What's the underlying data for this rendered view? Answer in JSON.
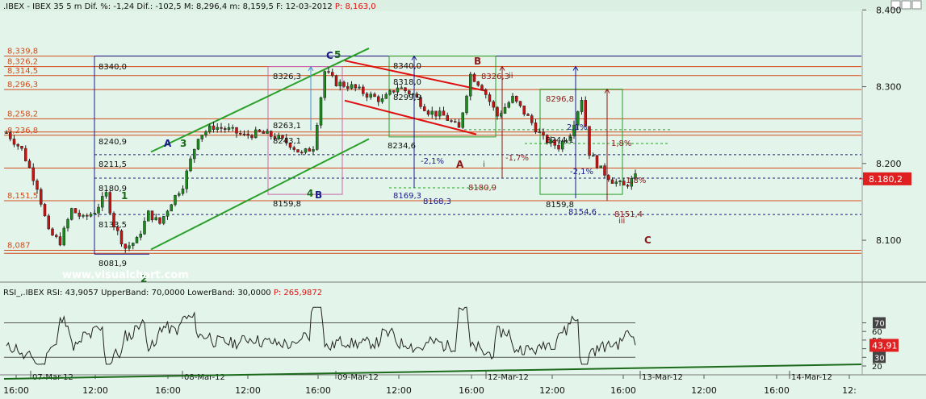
{
  "header": {
    "symbol": ".IBEX - IBEX 35",
    "timeframe": "5 m",
    "dif_pct_label": "Dif. %:",
    "dif_pct": "-1,24",
    "dif_label": "Dif.:",
    "dif": "-102,5",
    "max_label": "M:",
    "max": "8,296,4",
    "min_label": "m:",
    "min": "8,159,5",
    "date_label": "F:",
    "date": "12-03-2012",
    "price_label": "P:",
    "price": "8,163,0"
  },
  "watermark": "www.visualchart.com",
  "rsi_header": {
    "name": "RSI_,.IBEX",
    "rsi_label": "RSI:",
    "rsi": "43,9057",
    "upper_label": "UpperBand:",
    "upper": "70,0000",
    "lower_label": "LowerBand:",
    "lower": "30,0000",
    "p_label": "P:",
    "p": "265,9872"
  },
  "colors": {
    "background": "#e3f5ea",
    "up_candle": "#1a8c1a",
    "down_candle": "#cc1111",
    "wick": "#222222",
    "price_line": "#d44a1a",
    "blue_line": "#1a1a8c",
    "channel_green": "#2aa02a",
    "channel_red": "#e01010",
    "fib_pink": "#cc66aa",
    "rsi_line": "#222222",
    "rsi_band": "#555555",
    "last_price_box": "#e02020"
  },
  "chart_data": [
    {
      "type": "candlestick",
      "title": ".IBEX - IBEX 35 5 m",
      "ylim": [
        8060,
        8450
      ],
      "y_ticks": [
        "8.400",
        "8.300",
        "8.200",
        "8.100"
      ],
      "last_price": "8.180,2",
      "time_labels": [
        "16:00",
        "12:00",
        "16:00",
        "12:00",
        "16:00",
        "12:00",
        "16:00",
        "12:00",
        "16:00",
        "12:00",
        "16:00",
        "12:"
      ],
      "date_labels": [
        "07-Mar-12",
        "08-Mar-12",
        "09-Mar-12",
        "12-Mar-12",
        "13-Mar-12",
        "14-Mar-12"
      ],
      "key_points": [
        {
          "t": 0,
          "v": 8240
        },
        {
          "t": 4,
          "v": 8218
        },
        {
          "t": 8,
          "v": 8170
        },
        {
          "t": 11,
          "v": 8110
        },
        {
          "t": 14,
          "v": 8098
        },
        {
          "t": 17,
          "v": 8140
        },
        {
          "t": 20,
          "v": 8128
        },
        {
          "t": 23,
          "v": 8138
        },
        {
          "t": 26,
          "v": 8160
        },
        {
          "t": 28,
          "v": 8120
        },
        {
          "t": 31,
          "v": 8090
        },
        {
          "t": 34,
          "v": 8100
        },
        {
          "t": 37,
          "v": 8135
        },
        {
          "t": 40,
          "v": 8122
        },
        {
          "t": 43,
          "v": 8150
        },
        {
          "t": 46,
          "v": 8172
        },
        {
          "t": 50,
          "v": 8236
        },
        {
          "t": 54,
          "v": 8248
        },
        {
          "t": 58,
          "v": 8244
        },
        {
          "t": 62,
          "v": 8236
        },
        {
          "t": 66,
          "v": 8240
        },
        {
          "t": 70,
          "v": 8235
        },
        {
          "t": 74,
          "v": 8225
        },
        {
          "t": 77,
          "v": 8212
        },
        {
          "t": 80,
          "v": 8222
        },
        {
          "t": 83,
          "v": 8320
        },
        {
          "t": 86,
          "v": 8305
        },
        {
          "t": 90,
          "v": 8300
        },
        {
          "t": 94,
          "v": 8290
        },
        {
          "t": 98,
          "v": 8282
        },
        {
          "t": 102,
          "v": 8300
        },
        {
          "t": 106,
          "v": 8290
        },
        {
          "t": 110,
          "v": 8268
        },
        {
          "t": 114,
          "v": 8262
        },
        {
          "t": 118,
          "v": 8245
        },
        {
          "t": 121,
          "v": 8316
        },
        {
          "t": 124,
          "v": 8300
        },
        {
          "t": 128,
          "v": 8262
        },
        {
          "t": 132,
          "v": 8285
        },
        {
          "t": 136,
          "v": 8260
        },
        {
          "t": 140,
          "v": 8232
        },
        {
          "t": 144,
          "v": 8222
        },
        {
          "t": 147,
          "v": 8240
        },
        {
          "t": 150,
          "v": 8285
        },
        {
          "t": 152,
          "v": 8214
        },
        {
          "t": 155,
          "v": 8192
        },
        {
          "t": 158,
          "v": 8178
        },
        {
          "t": 161,
          "v": 8170
        },
        {
          "t": 164,
          "v": 8182
        }
      ],
      "annotations": [
        {
          "text": "1",
          "color": "#1a6a1a"
        },
        {
          "text": "A",
          "color": "#1a1a8c"
        },
        {
          "text": "3",
          "color": "#1a6a1a"
        },
        {
          "text": "C",
          "color": "#1a1a8c"
        },
        {
          "text": "5",
          "color": "#1a6a1a"
        },
        {
          "text": "4",
          "color": "#1a6a1a"
        },
        {
          "text": "B",
          "color": "#1a1a8c"
        },
        {
          "text": "B",
          "color": "#8b1a1a"
        },
        {
          "text": "A",
          "color": "#8b1a1a"
        },
        {
          "text": "C",
          "color": "#8b1a1a"
        },
        {
          "text": "2",
          "color": "#1a6a1a"
        }
      ],
      "left_price_labels": [
        "8,339,8",
        "8,326,2",
        "8,314,5",
        "8,296,3",
        "8,258,2",
        "8,236,8",
        "8,151,5",
        "8,087"
      ],
      "level_labels": [
        "8340,0",
        "8240,9",
        "8211,5",
        "8180,9",
        "8133,5",
        "8081,9",
        "8326,3",
        "8263,1",
        "8243,1",
        "8159,8",
        "8340,0",
        "8318,0",
        "8299,9",
        "8234,6",
        "8169,3",
        "8168,3",
        "8326,3",
        "8180,9",
        "8296,8",
        "8244,1",
        "8159,8",
        "8154,6",
        "8151,4",
        "-2,1%",
        "2,1%",
        "-2,1%",
        "1,8%",
        "-1,7%",
        "1,8%",
        "ii",
        "i",
        "iii"
      ]
    },
    {
      "type": "line",
      "title": "RSI",
      "ylim": [
        10,
        90
      ],
      "y_ticks": [
        "70",
        "60",
        "50",
        "40",
        "30",
        "20"
      ],
      "last_value": "43,91",
      "bands": [
        30,
        70
      ]
    }
  ]
}
